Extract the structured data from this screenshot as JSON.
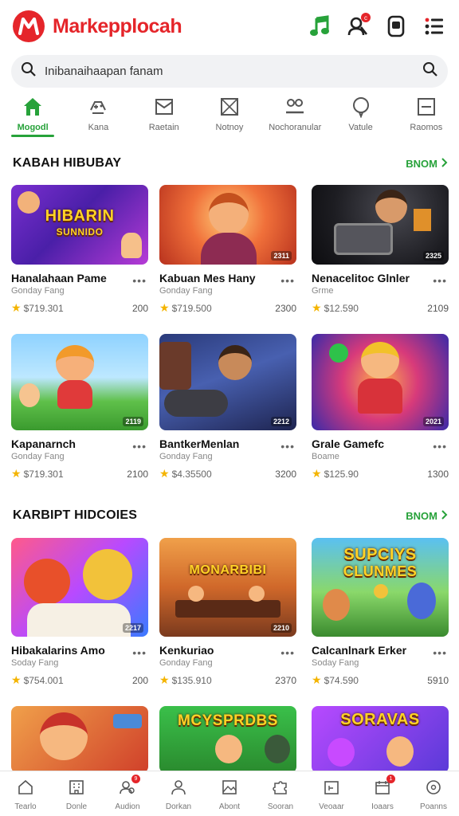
{
  "header": {
    "brand": "Markepplocah",
    "badge_count": "c"
  },
  "search": {
    "placeholder": "Inibanaihaapan fanam"
  },
  "categories": [
    {
      "label": "Mogodl",
      "icon": "home-icon",
      "active": true
    },
    {
      "label": "Kana",
      "icon": "controller-icon"
    },
    {
      "label": "Raetain",
      "icon": "envelope-icon"
    },
    {
      "label": "Notnoy",
      "icon": "box-icon"
    },
    {
      "label": "Nochoranular",
      "icon": "people-icon"
    },
    {
      "label": "Vatule",
      "icon": "chat-bubble-icon"
    },
    {
      "label": "Raomos",
      "icon": "window-icon"
    }
  ],
  "sections": [
    {
      "title": "KABAH HIBUBAY",
      "more": "BNOM"
    },
    {
      "title": "KARBIPT HIDCOIES",
      "more": "BNOM"
    }
  ],
  "cards": [
    {
      "title": "Hanalahaan Pame",
      "subtitle": "Gonday Fang",
      "price": "$719.301",
      "count": "200",
      "thumb_text": "HIBARIN",
      "thumb_subtext": "SUNNIDO",
      "tag": ""
    },
    {
      "title": "Kabuan Mes Hany",
      "subtitle": "Gonday Fang",
      "price": "$719.500",
      "count": "2300",
      "thumb_text": "",
      "thumb_subtext": "",
      "tag": "2311"
    },
    {
      "title": "Nenacelitoc Glnler",
      "subtitle": "Grme",
      "price": "$12.590",
      "count": "2109",
      "thumb_text": "",
      "thumb_subtext": "",
      "tag": "2325"
    },
    {
      "title": "Kapanarnch",
      "subtitle": "Gonday Fang",
      "price": "$719.301",
      "count": "2100",
      "thumb_text": "",
      "thumb_subtext": "",
      "tag": "2119"
    },
    {
      "title": "BantkerMenlan",
      "subtitle": "Gonday Fang",
      "price": "$4.35500",
      "count": "3200",
      "thumb_text": "",
      "thumb_subtext": "",
      "tag": "2212"
    },
    {
      "title": "Grale Gamefc",
      "subtitle": "Boame",
      "price": "$125.90",
      "count": "1300",
      "thumb_text": "",
      "thumb_subtext": "",
      "tag": "2021"
    },
    {
      "title": "Hibakalarins Amo",
      "subtitle": "Soday Fang",
      "price": "$754.001",
      "count": "200",
      "thumb_text": "",
      "thumb_subtext": "",
      "tag": "2217"
    },
    {
      "title": "Kenkuriao",
      "subtitle": "Gonday Fang",
      "price": "$135.910",
      "count": "2370",
      "thumb_text": "MONARBIBI",
      "thumb_subtext": "",
      "tag": "2210"
    },
    {
      "title": "Calcanlnark Erker",
      "subtitle": "Soday Fang",
      "price": "$74.590",
      "count": "5910",
      "thumb_text": "SUPCIYS",
      "thumb_subtext": "CLUNMES",
      "tag": ""
    },
    {
      "title": "",
      "subtitle": "",
      "price": "",
      "count": "",
      "thumb_text": "",
      "thumb_subtext": "",
      "tag": ""
    },
    {
      "title": "",
      "subtitle": "",
      "price": "",
      "count": "",
      "thumb_text": "MCYSPRDBS",
      "thumb_subtext": "",
      "tag": ""
    },
    {
      "title": "",
      "subtitle": "",
      "price": "",
      "count": "",
      "thumb_text": "SORAVAS",
      "thumb_subtext": "",
      "tag": ""
    }
  ],
  "bottom_nav": [
    {
      "label": "Tearlo",
      "icon": "home-outline-icon"
    },
    {
      "label": "Donle",
      "icon": "building-icon"
    },
    {
      "label": "Audion",
      "icon": "user-group-icon",
      "badge": "9"
    },
    {
      "label": "Dorkan",
      "icon": "person-icon"
    },
    {
      "label": "Abont",
      "icon": "image-icon"
    },
    {
      "label": "Sooran",
      "icon": "puzzle-icon"
    },
    {
      "label": "Veoaar",
      "icon": "tv-icon"
    },
    {
      "label": "Ioaars",
      "icon": "calendar-icon",
      "badge": "1"
    },
    {
      "label": "Poanns",
      "icon": "settings-circle-icon"
    }
  ],
  "colors": {
    "brand_red": "#e5252a",
    "accent_green": "#27a23a",
    "star": "#f4b400"
  }
}
